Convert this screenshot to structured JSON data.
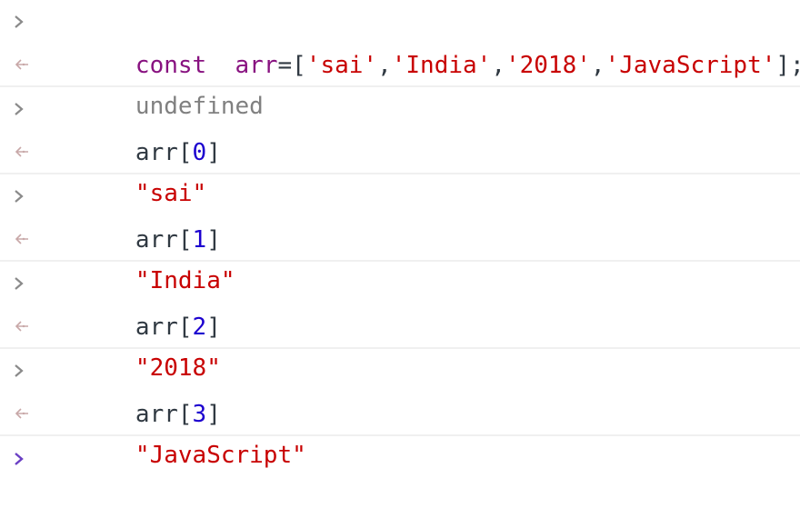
{
  "console": {
    "entries": [
      {
        "input": {
          "keyword": "const",
          "space": "  ",
          "varname": "arr",
          "assign": "=[",
          "s1": "'sai'",
          "c1": ",",
          "s2": "'India'",
          "c2": ",",
          "s3": "'2018'",
          "c3": ",",
          "s4": "'JavaScript'",
          "end": "];"
        },
        "output": "undefined"
      },
      {
        "input": {
          "pre": "arr[",
          "index": "0",
          "post": "]"
        },
        "output": "\"sai\""
      },
      {
        "input": {
          "pre": "arr[",
          "index": "1",
          "post": "]"
        },
        "output": "\"India\""
      },
      {
        "input": {
          "pre": "arr[",
          "index": "2",
          "post": "]"
        },
        "output": "\"2018\""
      },
      {
        "input": {
          "pre": "arr[",
          "index": "3",
          "post": "]"
        },
        "output": "\"JavaScript\""
      }
    ]
  },
  "icons": {
    "prompt": "chevron-right-icon",
    "result": "return-arrow-icon"
  },
  "colors": {
    "keyword": "#881280",
    "string": "#c80000",
    "number": "#1c00cf",
    "undefined": "#808080",
    "prompt_active": "#2f6bc4"
  }
}
